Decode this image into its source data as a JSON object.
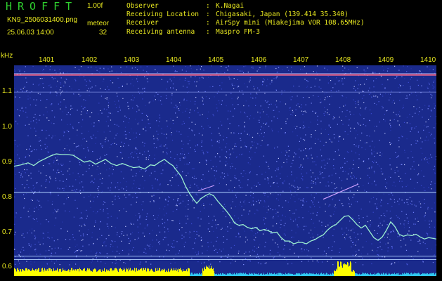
{
  "header": {
    "logo": "HROFFT",
    "version": "1.00f",
    "filename": "KN9_2506031400.png",
    "meteor_label": "meteor",
    "datetime": "25.06.03 14:00",
    "meteor_count": "32"
  },
  "info": [
    {
      "key": "Observer",
      "value": "K.Nagai"
    },
    {
      "key": "Receiving Location",
      "value": "Chigasaki, Japan (139.414 35.340)"
    },
    {
      "key": "Receiver",
      "value": "AirSpy mini (Miakejima VOR 108.65MHz)"
    },
    {
      "key": "Receiving antenna",
      "value": "Maspro FM-3"
    }
  ],
  "time_axis": {
    "ticks": [
      "1401",
      "1402",
      "1403",
      "1404",
      "1405",
      "1406",
      "1407",
      "1408",
      "1409",
      "1410"
    ]
  },
  "freq_axis": {
    "unit": "kHz",
    "ticks": [
      "1.1",
      "1.0",
      "0.9",
      "0.8",
      "0.7",
      "0.6"
    ]
  },
  "colors": {
    "background": "#000000",
    "text": "#e8e820",
    "logo": "#2fd02f",
    "noise": "#1a2a8c",
    "trace": "#9cf0d0",
    "carrier": "#ff6a8a",
    "bar_yellow": "#ffff00",
    "bar_cyan": "#30c8f0"
  }
}
